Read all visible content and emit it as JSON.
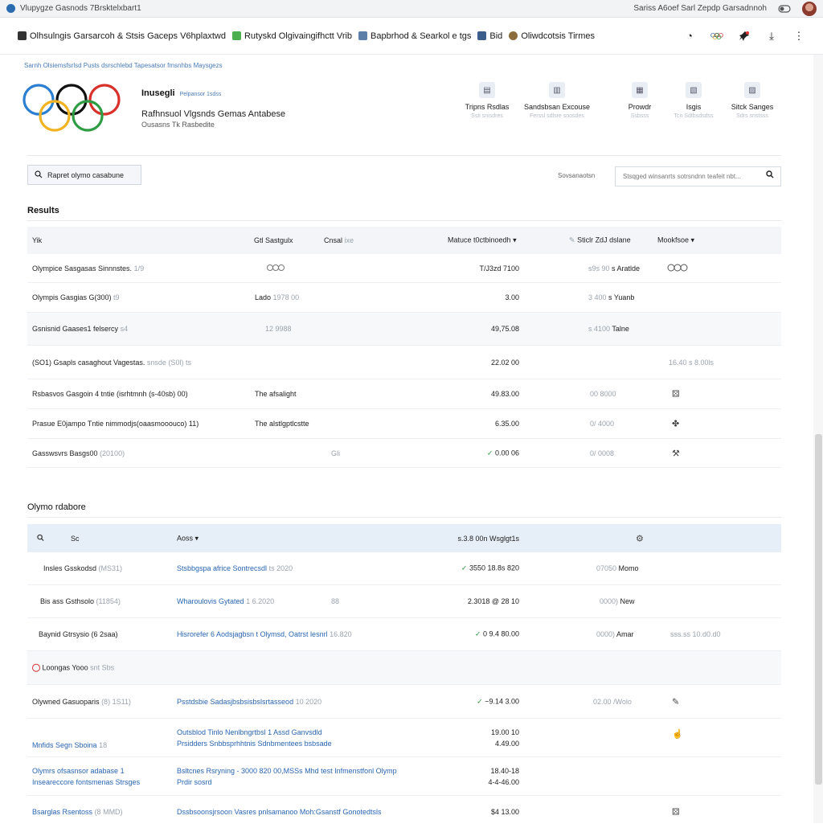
{
  "window": {
    "title": "Vlupygze Gasnods 7Brsktelxbart1",
    "right_text": "Sariss A6oef Sarl Zepdp Garsadnnoh"
  },
  "bookmarks": [
    {
      "label": "Olhsulngis Garsarcoh & Stsis Gaceps V6hplaxtwd",
      "color": "#333"
    },
    {
      "label": "Rutyskd Olgivaingifhctt Vrib",
      "color": "#4caf50"
    },
    {
      "label": "Bapbrhod & Searkol e tgs",
      "color": "#5c7fa8"
    },
    {
      "label": "Bid",
      "color": "#3b5e8c"
    },
    {
      "label": "Oliwdcotsis Tirmes",
      "color": "#8a6d3b"
    }
  ],
  "toolbar": {
    "history_icon": "clock-icon",
    "rings_icon": "olympic-rings-icon",
    "pin_icon": "pin-icon",
    "download_icon": "download-icon",
    "menu_icon": "kebab-menu-icon"
  },
  "breadcrumb": "Sarnh Olsiemsfsrlsd Pusts dsrschlebd Tapesatsor fmsnhbs Maysgezs",
  "hero": {
    "title": "Inusegli",
    "tag": "Pelpansor 1sdss",
    "subtitle": "Rafhnsuol Vlgsnds Gemas Antabese",
    "caption": "Ousasns Tk Rasbedite",
    "links": [
      {
        "label": "Tripns Rsdlas",
        "sub": "Ssti snisdres"
      },
      {
        "label": "Sandsbsan Excouse",
        "sub": "Ferssl sdlsre snosdes"
      },
      {
        "label": "Prowdr",
        "sub": "Ssbsss"
      },
      {
        "label": "Isgis",
        "sub": "Tcn Sdtbsdsdss"
      },
      {
        "label": "Sitck Sanges",
        "sub": "Sdrs snstsss"
      }
    ]
  },
  "report": {
    "label": "Rapret olymo casabune"
  },
  "search": {
    "label": "Sovsanaotsn",
    "placeholder": "Stsqged winsanrts sotrsndnn teafeit nbt..."
  },
  "results": {
    "title": "Results",
    "headers": {
      "c1": "Yik",
      "c2": "Gtl Sastgulx",
      "c3": "Cnsal",
      "c3b": "ixe",
      "c4": "Matuce t0ctbinoedh",
      "c5": "Sticlr ZdJ dslane",
      "c6": "Mookfsoe"
    },
    "rows": [
      {
        "name": "Olympice Sasgasas Sinnnstes.",
        "name_sub": "1/9",
        "c2": "",
        "c4": "T/J3zd 7100",
        "c5": "s9s 90",
        "c5b": "s Aratlde",
        "icon": "olympic-rings-icon"
      },
      {
        "name": "Olympis Gasgias G(300)",
        "name_sub": "t9",
        "c2": "Lado",
        "c2_sub": "1978 00",
        "c4": "3.00",
        "c5": "3 400",
        "c5b": "s Yuanb"
      },
      {
        "name": "Gsnisnid Gaases1 felsercy",
        "name_sub": "s4",
        "c2": "12 9988",
        "c4": "49,75.08",
        "c5": "s 4100",
        "c5b": "Talne"
      },
      {
        "name": "(SO1) Gsapls casaghout Vagestas.",
        "name_sub": "snsde (S0l) ts",
        "c2": "",
        "c4": "22.02 00",
        "c5": "",
        "c6": "16.40 s 8.00ls"
      },
      {
        "name": "Rsbasvos Gasgoin 4 tntie (isrhtmnh (s-40sb) 00)",
        "c2": "The afsalight",
        "c4": "49.83.00",
        "c5": "00 8000",
        "icon": "dice-icon"
      },
      {
        "name": "Prasue E0jampo Tntie nimmodjs(oaasmooouco) 11)",
        "c2": "The alstlgptlcstte",
        "c4": "6.35.00",
        "c5": "0/ 4000",
        "icon": "puzzle-icon"
      },
      {
        "name": "Gasswsvrs Basgs00",
        "name_sub": "(20100)",
        "c2": "Gli",
        "c4": "0.00 06",
        "c4_check": "true",
        "c5": "0/ 0008",
        "icon": "tools-icon"
      }
    ]
  },
  "database": {
    "title": "Olymo rdabore",
    "headers": {
      "c1": "Sc",
      "c2": "Aoss",
      "c3": "s.3.8 00n Wsglgt1s",
      "c4": "gear-icon"
    },
    "rows": [
      {
        "name": "Insles Gsskodsd",
        "name_sub": "(MS31)",
        "link": "Stsbbgspa africe Sontrecsdl",
        "link_sub": "ts 2020",
        "value": "3550 18.8s 820",
        "check": "true",
        "c5": "07050",
        "c5b": "Momo"
      },
      {
        "name": "Bis ass Gsthsolo",
        "name_sub": "(11854)",
        "link": "Wharoulovis Gytated",
        "link_sub": "1 6.2020",
        "extra": "88",
        "value": "2.3018 @ 28 10",
        "c5": "0000)",
        "c5b": "New"
      },
      {
        "name": "Baynid Gtrsysio (6 2saa)",
        "link": "Hisrorefer 6 Aodsjagbsn t Olymsd, Oatrst lesnrl",
        "link_sub": "16.820",
        "value": "0 9.4 80.00",
        "check": "true",
        "c5": "0000)",
        "c5b": "Amar",
        "c6": "sss.ss 10.d0.d0"
      }
    ],
    "group": {
      "label": "Loongas Yooo",
      "sub": "snt Sbs"
    },
    "rows2": [
      {
        "name": "Olywned Gasuoparis",
        "name_sub": "(8) 1S11)",
        "link": "Psstdsbie Sadasjbsbsisbslsrtasseod",
        "link_sub": "10 2020",
        "value": "~9.14 3.00",
        "check": "true",
        "c5": "02.00",
        "c5b": "/Wolo",
        "icon": "pencil-icon"
      },
      {
        "name": "Mnfids Segn Sboina",
        "name_sub": "18",
        "link": "Outsblod Tinlo Nenlbngrtbsl 1 Assd Ganvsdld",
        "link2": "Prsidders Snbbsprhhtnis Sdnbmentees bsbsade",
        "value": "19.00 10",
        "value2": "4.49.00",
        "icon": "hand-icon"
      },
      {
        "name": "Olymrs ofsasnsor adabase",
        "name_sub": "1",
        "name2": "Inseareccore fontsmenas Strsges",
        "link": "Bsltcnes Rsryning - 3000 820 00,MSSs Mhd test Infmenstfonl Olymp",
        "link2": "Prdir sosrd",
        "value": "18.40-18",
        "value2": "4-4-46.00"
      },
      {
        "name": "Bsarglas Rsentoss",
        "name_sub": "(8 MMD)",
        "link": "Dssbsoonsjrsoon Vasres pnlsamanoo Moh:Gsanstf Gonotedtsls",
        "value": "$4 13.00",
        "icon": "dice-icon"
      }
    ]
  }
}
